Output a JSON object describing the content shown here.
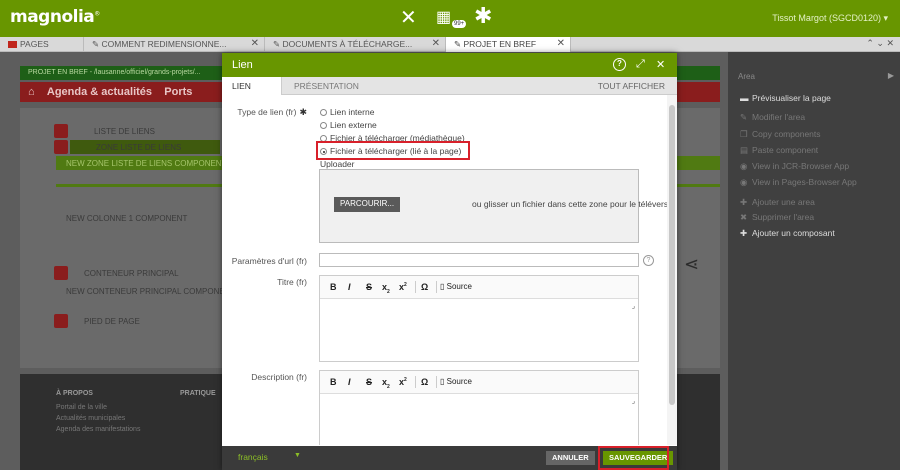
{
  "app": {
    "logo": "magnolia",
    "user": "Tissot Margot (SGCD0120)",
    "hub_badge": "99+"
  },
  "tabs": [
    {
      "label": "PAGES"
    },
    {
      "label": "COMMENT REDIMENSIONNE..."
    },
    {
      "label": "DOCUMENTS À TÉLÉCHARGE..."
    },
    {
      "label": "PROJET EN BREF"
    }
  ],
  "tab_controls": "⌃ ⌄ ✕",
  "background_page": {
    "breadcrumb": "PROJET EN BREF - /lausanne/officiel/grands-projets/...",
    "nav_title": "Agenda & actualités",
    "nav_partial": "Ports",
    "items": [
      "LISTE DE LIENS",
      "ZONE LISTE DE LIENS",
      "NEW ZONE LISTE DE LIENS COMPONENT",
      "NEW COLONNE 1 COMPONENT",
      "CONTENEUR PRINCIPAL",
      "NEW CONTENEUR PRINCIPAL COMPONENT",
      "PIED DE PAGE"
    ],
    "footer": [
      "À PROPOS",
      "Portail de la ville",
      "Actualités municipales",
      "Agenda des manifestations",
      "PRATIQUE"
    ]
  },
  "sidebar": {
    "header": "Area",
    "items": [
      {
        "label": "Prévisualiser la page",
        "active": true
      },
      {
        "label": "Modifier l'area",
        "active": false
      },
      {
        "label": "Copy components",
        "active": false
      },
      {
        "label": "Paste component",
        "active": false
      },
      {
        "label": "View in JCR-Browser App",
        "active": false
      },
      {
        "label": "View in Pages-Browser App",
        "active": false
      },
      {
        "label": "Ajouter une area",
        "active": false
      },
      {
        "label": "Supprimer l'area",
        "active": false
      },
      {
        "label": "Ajouter un composant",
        "active": true
      }
    ]
  },
  "dialog": {
    "title": "Lien",
    "tabs": [
      "LIEN",
      "PRÉSENTATION"
    ],
    "show_all": "TOUT AFFICHER",
    "link_type_label": "Type de lien (fr)",
    "required_mark": "✱",
    "link_options": [
      {
        "label": "Lien interne",
        "selected": false
      },
      {
        "label": "Lien externe",
        "selected": false
      },
      {
        "label": "Fichier à télécharger (médiathèque)",
        "selected": false
      },
      {
        "label": "Fichier à télécharger (lié à la page)",
        "selected": true
      }
    ],
    "uploader_label": "Uploader",
    "browse_button": "PARCOURIR...",
    "drop_text": "ou glisser un fichier dans cette zone pour le téléverser",
    "url_params_label": "Paramètres d'url (fr)",
    "url_params_value": "",
    "title_label": "Titre (fr)",
    "description_label": "Description (fr)",
    "rte_source": "Source",
    "language": "français",
    "cancel_button": "ANNULER",
    "save_button": "SAUVEGARDER"
  },
  "colors": {
    "brand": "#689600",
    "highlight": "#d8202a"
  }
}
